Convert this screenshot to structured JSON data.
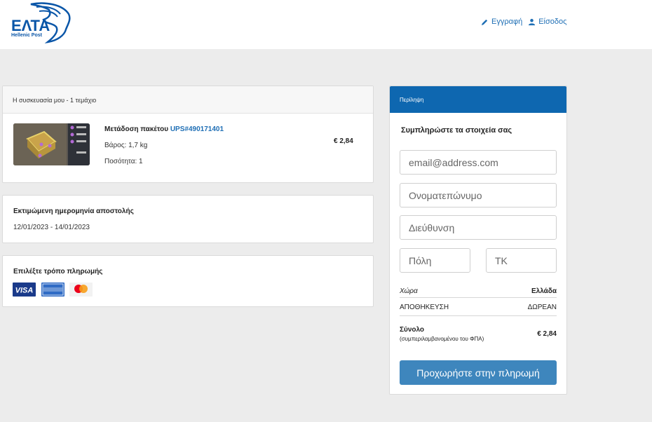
{
  "brand": {
    "name": "ΕΛΤΑ",
    "tagline": "Hellenic Post"
  },
  "header": {
    "register": "Εγγραφή",
    "login": "Είσοδος"
  },
  "package": {
    "heading": "Η συσκευασία μου - 1 τεμάχιο",
    "item_title": "Μετάδοση πακέτου",
    "item_code": "UPS#490171401",
    "weight": "Βάρος: 1,7 kg",
    "quantity": "Ποσότητα: 1",
    "price": "€ 2,84"
  },
  "delivery": {
    "title": "Εκτιμώμενη ημερομηνία αποστολής",
    "range": "12/01/2023 - 14/01/2023"
  },
  "payment": {
    "title": "Επιλέξτε τρόπο πληρωμής",
    "methods": [
      "visa",
      "amex",
      "mastercard"
    ]
  },
  "summary": {
    "heading": "Περίληψη",
    "title": "Συμπληρώστε τα στοιχεία σας",
    "email_placeholder": "email@address.com",
    "name_placeholder": "Ονοματεπώνυμο",
    "address_placeholder": "Διεύθυνση",
    "city_placeholder": "Πόλη",
    "zip_placeholder": "ΤΚ",
    "country_label": "Χώρα",
    "country_value": "Ελλάδα",
    "storage_label": "ΑΠΟΘΗΚΕΥΣΗ",
    "storage_value": "ΔΩΡΕΑΝ",
    "total_label": "Σύνολο",
    "total_note": "(συμπεριλαμβανομένου του ΦΠΑ)",
    "total_value": "€ 2,84",
    "cta": "Προχωρήστε στην πληρωμή"
  },
  "colors": {
    "brand_blue": "#0a56a8",
    "summary_header": "#0e67b0",
    "cta": "#3e86bd",
    "link": "#1f6fb5"
  }
}
